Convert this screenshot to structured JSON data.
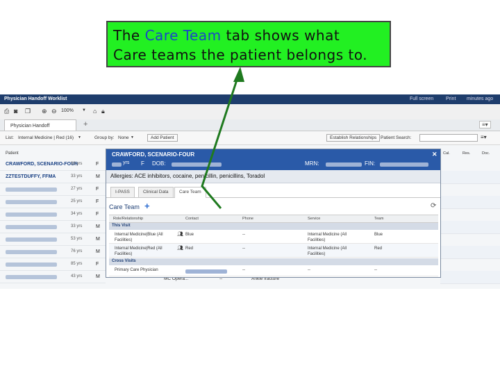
{
  "callout": {
    "line1_pre": "The ",
    "line1_highlight": "Care Team",
    "line1_post": " tab shows what",
    "line2": "Care teams the patient belongs to."
  },
  "app": {
    "title": "Physician Handoff Worklist",
    "title_actions": [
      "Full screen",
      "Print",
      "minutes ago"
    ],
    "zoom": "100%",
    "tab_label": "Physician Handoff",
    "add_tab": "+",
    "filter": {
      "list_label": "List:",
      "list_value": "Internal Medicine | Red (16)",
      "group_label": "Group by:",
      "group_value": "None",
      "add_patient": "Add Patient",
      "establish": "Establish Relationships",
      "search_label": "Patient Search:",
      "search_placeholder": ""
    },
    "columns_left": [
      "Patient"
    ],
    "columns_right": [
      "Cal.",
      "Res.",
      "Doc."
    ],
    "patients": [
      {
        "name": "CRAWFORD, SCENARIO-FOUR",
        "age": "33 yrs",
        "sex": "F"
      },
      {
        "name": "ZZTESTDUFFY, FFMA",
        "age": "33 yrs",
        "sex": "M"
      },
      {
        "name": "",
        "age": "27 yrs",
        "sex": "F"
      },
      {
        "name": "",
        "age": "25 yrs",
        "sex": "F"
      },
      {
        "name": "",
        "age": "34 yrs",
        "sex": "F"
      },
      {
        "name": "",
        "age": "33 yrs",
        "sex": "M"
      },
      {
        "name": "",
        "age": "53 yrs",
        "sex": "M"
      },
      {
        "name": "",
        "age": "76 yrs",
        "sex": "M"
      },
      {
        "name": "",
        "age": "85 yrs",
        "sex": "F"
      },
      {
        "name": "",
        "age": "43 yrs",
        "sex": "M"
      }
    ],
    "bottom_row_extra": {
      "loc": "MC Opera...",
      "dash": "--",
      "diag": "Ankle fracture"
    }
  },
  "popup": {
    "name": "CRAWFORD, SCENARIO-FOUR",
    "age_prefix": "yrs",
    "sex": "F",
    "dob_label": "DOB:",
    "mrn_label": "MRN:",
    "fin_label": "FIN:",
    "allergies": "Allergies: ACE inhibitors, cocaine, penicillin, penicillins, Toradol",
    "tabs": [
      "I-PASS",
      "Clinical Data",
      "Care Team"
    ],
    "active_tab": "Care Team",
    "section_title": "Care Team",
    "table_headers": [
      "Role/Relationship",
      "Contact",
      "Phone",
      "Service",
      "Team"
    ],
    "sections": [
      {
        "title": "This Visit",
        "rows": [
          {
            "role": "Internal Medicine|Blue (All Facilities)",
            "contact": "Blue",
            "phone": "--",
            "service": "Internal Medicine (All Facilities)",
            "team": "Blue"
          },
          {
            "role": "Internal Medicine|Red (All Facilities)",
            "contact": "Red",
            "phone": "--",
            "service": "Internal Medicine (All Facilities)",
            "team": "Red"
          }
        ]
      },
      {
        "title": "Cross Visits",
        "rows": [
          {
            "role": "Primary Care Physician",
            "contact": "",
            "phone": "--",
            "service": "--",
            "team": "--"
          }
        ]
      }
    ]
  },
  "colors": {
    "header_blue": "#2a5aa8",
    "callout_green": "#22f022",
    "arrow_green": "#1f7a1f",
    "highlight_blue": "#1a46c8"
  }
}
